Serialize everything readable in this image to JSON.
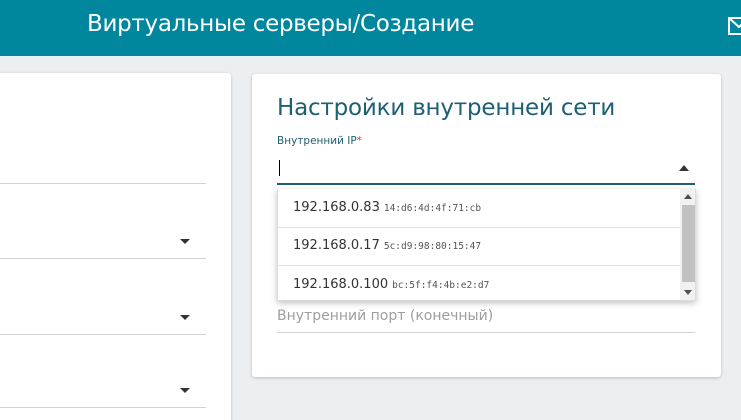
{
  "header": {
    "title": "Виртуальные серверы/Создание",
    "right_icon": "mail-icon"
  },
  "section": {
    "title": "Настройки внутренней сети",
    "ip_field": {
      "label": "Внутренний IP",
      "required_mark": "*",
      "value": ""
    },
    "port_end_field": {
      "placeholder": "Внутренний порт (конечный)"
    }
  },
  "dropdown": {
    "options": [
      {
        "ip": "192.168.0.83",
        "mac": "14:d6:4d:4f:71:cb"
      },
      {
        "ip": "192.168.0.17",
        "mac": "5c:d9:98:80:15:47"
      },
      {
        "ip": "192.168.0.100",
        "mac": "bc:5f:f4:4b:e2:d7"
      }
    ]
  },
  "colors": {
    "header_bg": "#00879e",
    "accent": "#1e5f74",
    "required": "#e53935"
  }
}
